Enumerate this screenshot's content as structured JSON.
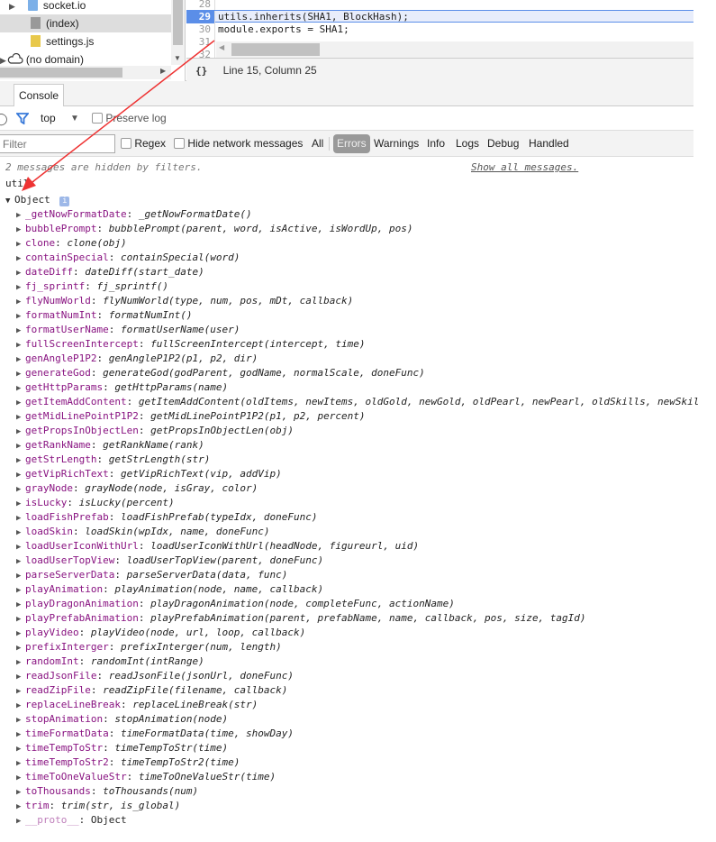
{
  "sources": {
    "tree": [
      {
        "label": "socket.io",
        "icon": "folder-icon"
      },
      {
        "label": "(index)",
        "icon": "file-icon",
        "selected": true
      },
      {
        "label": "settings.js",
        "icon": "js-file-icon"
      },
      {
        "label": "(no domain)",
        "icon": "cloud-icon"
      }
    ]
  },
  "editor": {
    "lines": [
      {
        "num": "28",
        "code": ""
      },
      {
        "num": "29",
        "code": "utils.inherits(SHA1, BlockHash);",
        "highlighted": true
      },
      {
        "num": "30",
        "code": "module.exports = SHA1;"
      },
      {
        "num": "31",
        "code": ""
      },
      {
        "num": "32",
        "code": ""
      }
    ],
    "status": "Line 15, Column 25",
    "format_icon": "{}"
  },
  "tabs": [
    {
      "label": "Console",
      "active": true
    }
  ],
  "toolbar": {
    "context": "top",
    "preserve_log": "Preserve log"
  },
  "filter": {
    "placeholder": "Filter",
    "regex": "Regex",
    "hide_network": "Hide network messages",
    "levels": [
      "All",
      "Errors",
      "Warnings",
      "Info",
      "Logs",
      "Debug",
      "Handled"
    ],
    "active_level": "Errors"
  },
  "console": {
    "hidden_msg": "2 messages are hidden by filters.",
    "show_all": "Show all messages.",
    "input": "utils",
    "object_label": "Object",
    "properties": [
      [
        "_getNowFormatDate",
        "_getNowFormatDate()"
      ],
      [
        "bubblePrompt",
        "bubblePrompt(parent, word, isActive, isWordUp, pos)"
      ],
      [
        "clone",
        "clone(obj)"
      ],
      [
        "containSpecial",
        "containSpecial(word)"
      ],
      [
        "dateDiff",
        "dateDiff(start_date)"
      ],
      [
        "fj_sprintf",
        "fj_sprintf()"
      ],
      [
        "flyNumWorld",
        "flyNumWorld(type, num, pos, mDt, callback)"
      ],
      [
        "formatNumInt",
        "formatNumInt()"
      ],
      [
        "formatUserName",
        "formatUserName(user)"
      ],
      [
        "fullScreenIntercept",
        "fullScreenIntercept(intercept, time)"
      ],
      [
        "genAngleP1P2",
        "genAngleP1P2(p1, p2, dir)"
      ],
      [
        "generateGod",
        "generateGod(godParent, godName, normalScale, doneFunc)"
      ],
      [
        "getHttpParams",
        "getHttpParams(name)"
      ],
      [
        "getItemAddContent",
        "getItemAddContent(oldItems, newItems, oldGold, newGold, oldPearl, newPearl, oldSkills, newSkil"
      ],
      [
        "getMidLinePointP1P2",
        "getMidLinePointP1P2(p1, p2, percent)"
      ],
      [
        "getPropsInObjectLen",
        "getPropsInObjectLen(obj)"
      ],
      [
        "getRankName",
        "getRankName(rank)"
      ],
      [
        "getStrLength",
        "getStrLength(str)"
      ],
      [
        "getVipRichText",
        "getVipRichText(vip, addVip)"
      ],
      [
        "grayNode",
        "grayNode(node, isGray, color)"
      ],
      [
        "isLucky",
        "isLucky(percent)"
      ],
      [
        "loadFishPrefab",
        "loadFishPrefab(typeIdx, doneFunc)"
      ],
      [
        "loadSkin",
        "loadSkin(wpIdx, name, doneFunc)"
      ],
      [
        "loadUserIconWithUrl",
        "loadUserIconWithUrl(headNode, figureurl, uid)"
      ],
      [
        "loadUserTopView",
        "loadUserTopView(parent, doneFunc)"
      ],
      [
        "parseServerData",
        "parseServerData(data, func)"
      ],
      [
        "playAnimation",
        "playAnimation(node, name, callback)"
      ],
      [
        "playDragonAnimation",
        "playDragonAnimation(node, completeFunc, actionName)"
      ],
      [
        "playPrefabAnimation",
        "playPrefabAnimation(parent, prefabName, name, callback, pos, size, tagId)"
      ],
      [
        "playVideo",
        "playVideo(node, url, loop, callback)"
      ],
      [
        "prefixInterger",
        "prefixInterger(num, length)"
      ],
      [
        "randomInt",
        "randomInt(intRange)"
      ],
      [
        "readJsonFile",
        "readJsonFile(jsonUrl, doneFunc)"
      ],
      [
        "readZipFile",
        "readZipFile(filename, callback)"
      ],
      [
        "replaceLineBreak",
        "replaceLineBreak(str)"
      ],
      [
        "stopAnimation",
        "stopAnimation(node)"
      ],
      [
        "timeFormatData",
        "timeFormatData(time, showDay)"
      ],
      [
        "timeTempToStr",
        "timeTempToStr(time)"
      ],
      [
        "timeTempToStr2",
        "timeTempToStr2(time)"
      ],
      [
        "timeToOneValueStr",
        "timeToOneValueStr(time)"
      ],
      [
        "toThousands",
        "toThousands(num)"
      ],
      [
        "trim",
        "trim(str, is_global)"
      ]
    ],
    "proto_key": "__proto__",
    "proto_val": "Object"
  },
  "colors": {
    "key": "#881280",
    "highlight": "#e8edfb",
    "line_active": "#5b8ee8",
    "arrow": "#ee3333"
  }
}
